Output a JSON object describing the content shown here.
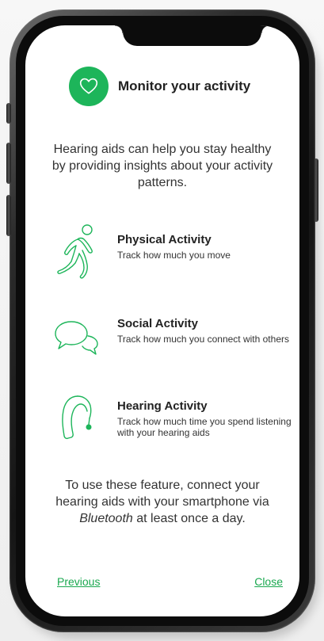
{
  "header": {
    "title": "Monitor your activity",
    "icon": "heart-icon"
  },
  "intro": "Hearing aids can help you stay healthy by providing insights about your activity patterns.",
  "features": [
    {
      "icon": "walking-person-icon",
      "title": "Physical Activity",
      "description": "Track how much you move"
    },
    {
      "icon": "speech-bubbles-icon",
      "title": "Social Activity",
      "description": "Track how much you connect with others"
    },
    {
      "icon": "hearing-aid-icon",
      "title": "Hearing Activity",
      "description": "Track how much time you spend listening with your hearing aids"
    }
  ],
  "footer": {
    "before": "To use these feature, connect your hearing aids with your smartphone via ",
    "emphasis": "Bluetooth",
    "after": " at least once a day."
  },
  "nav": {
    "previous": "Previous",
    "close": "Close"
  },
  "colors": {
    "accent": "#1db55a",
    "link": "#1aa84f",
    "text": "#333333"
  }
}
